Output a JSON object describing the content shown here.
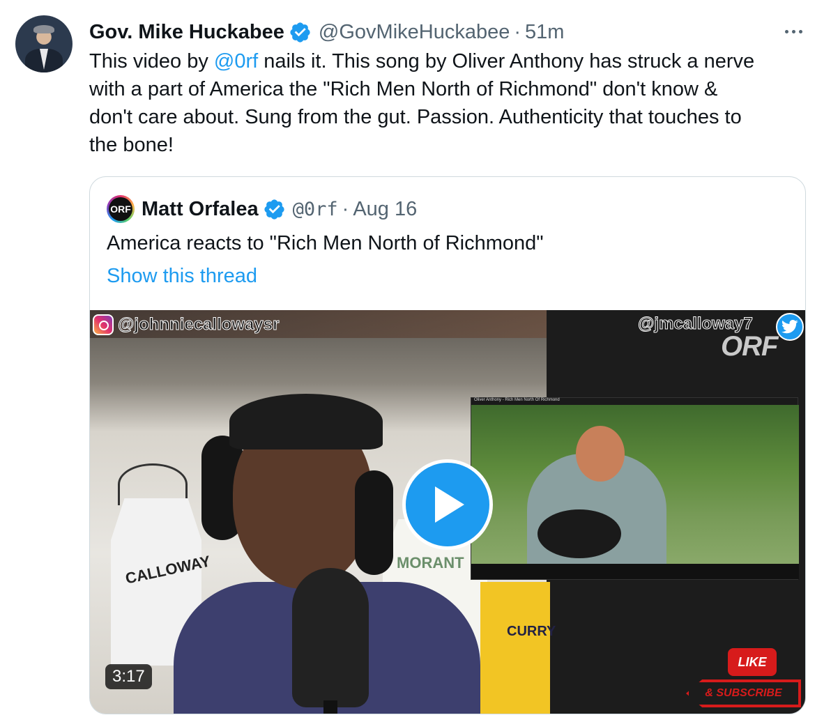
{
  "tweet": {
    "author_name": "Gov. Mike Huckabee",
    "handle": "@GovMikeHuckabee",
    "separator": "·",
    "time": "51m",
    "text_lines": [
      [
        "This video by ",
        "@0rf",
        " nails it. This song by Oliver Anthony has struck a nerve"
      ],
      "with a part of America the \"Rich Men North of Richmond\" don't know &",
      "don't care about.  Sung from the gut. Passion. Authenticity that touches to",
      "the bone!"
    ]
  },
  "quote": {
    "logo_text": "ORF",
    "author_name": "Matt Orfalea",
    "handle": "@0rf",
    "separator": "·",
    "date": "Aug 16",
    "text": "America reacts to \"Rich Men North of Richmond\"",
    "show_thread": "Show this thread"
  },
  "video": {
    "instagram_tag": "@johnniecallowaysr",
    "twitter_tag": "@jmcalloway7",
    "watermark": "ORF",
    "jersey_left": "CALLOWAY",
    "jersey_mid": "MORANT",
    "jersey_right": "CURRY",
    "inner_title": "Oliver Anthony - Rich Men North Of Richmond",
    "like_label": "LIKE",
    "subscribe_label": "& SUBSCRIBE",
    "duration": "3:17"
  },
  "colors": {
    "accent": "#1d9bf0",
    "text": "#0f1419",
    "secondary": "#536471",
    "border": "#cfd9de"
  },
  "icons": [
    "verified-badge-icon",
    "more-icon",
    "play-icon",
    "instagram-icon",
    "twitter-bird-icon"
  ]
}
